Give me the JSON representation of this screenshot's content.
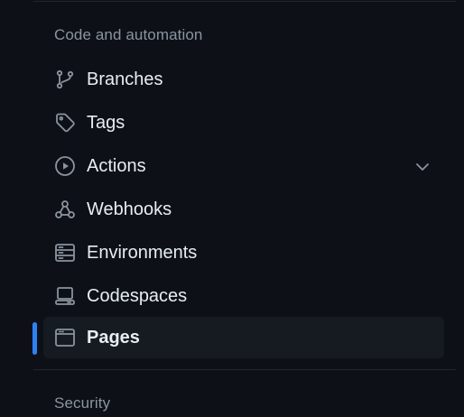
{
  "sections": {
    "code_automation_heading": "Code and automation",
    "security_heading": "Security"
  },
  "nav": {
    "items": [
      {
        "label": "Branches",
        "icon": "git-branch-icon"
      },
      {
        "label": "Tags",
        "icon": "tag-icon"
      },
      {
        "label": "Actions",
        "icon": "play-icon",
        "expandable": true
      },
      {
        "label": "Webhooks",
        "icon": "webhook-icon"
      },
      {
        "label": "Environments",
        "icon": "server-icon"
      },
      {
        "label": "Codespaces",
        "icon": "codespaces-icon"
      },
      {
        "label": "Pages",
        "icon": "browser-icon",
        "active": true
      }
    ]
  },
  "colors": {
    "background": "#0d1117",
    "active_bg": "#161b22",
    "accent": "#2f81f7",
    "text": "#e6edf3",
    "muted": "#8b949e"
  }
}
